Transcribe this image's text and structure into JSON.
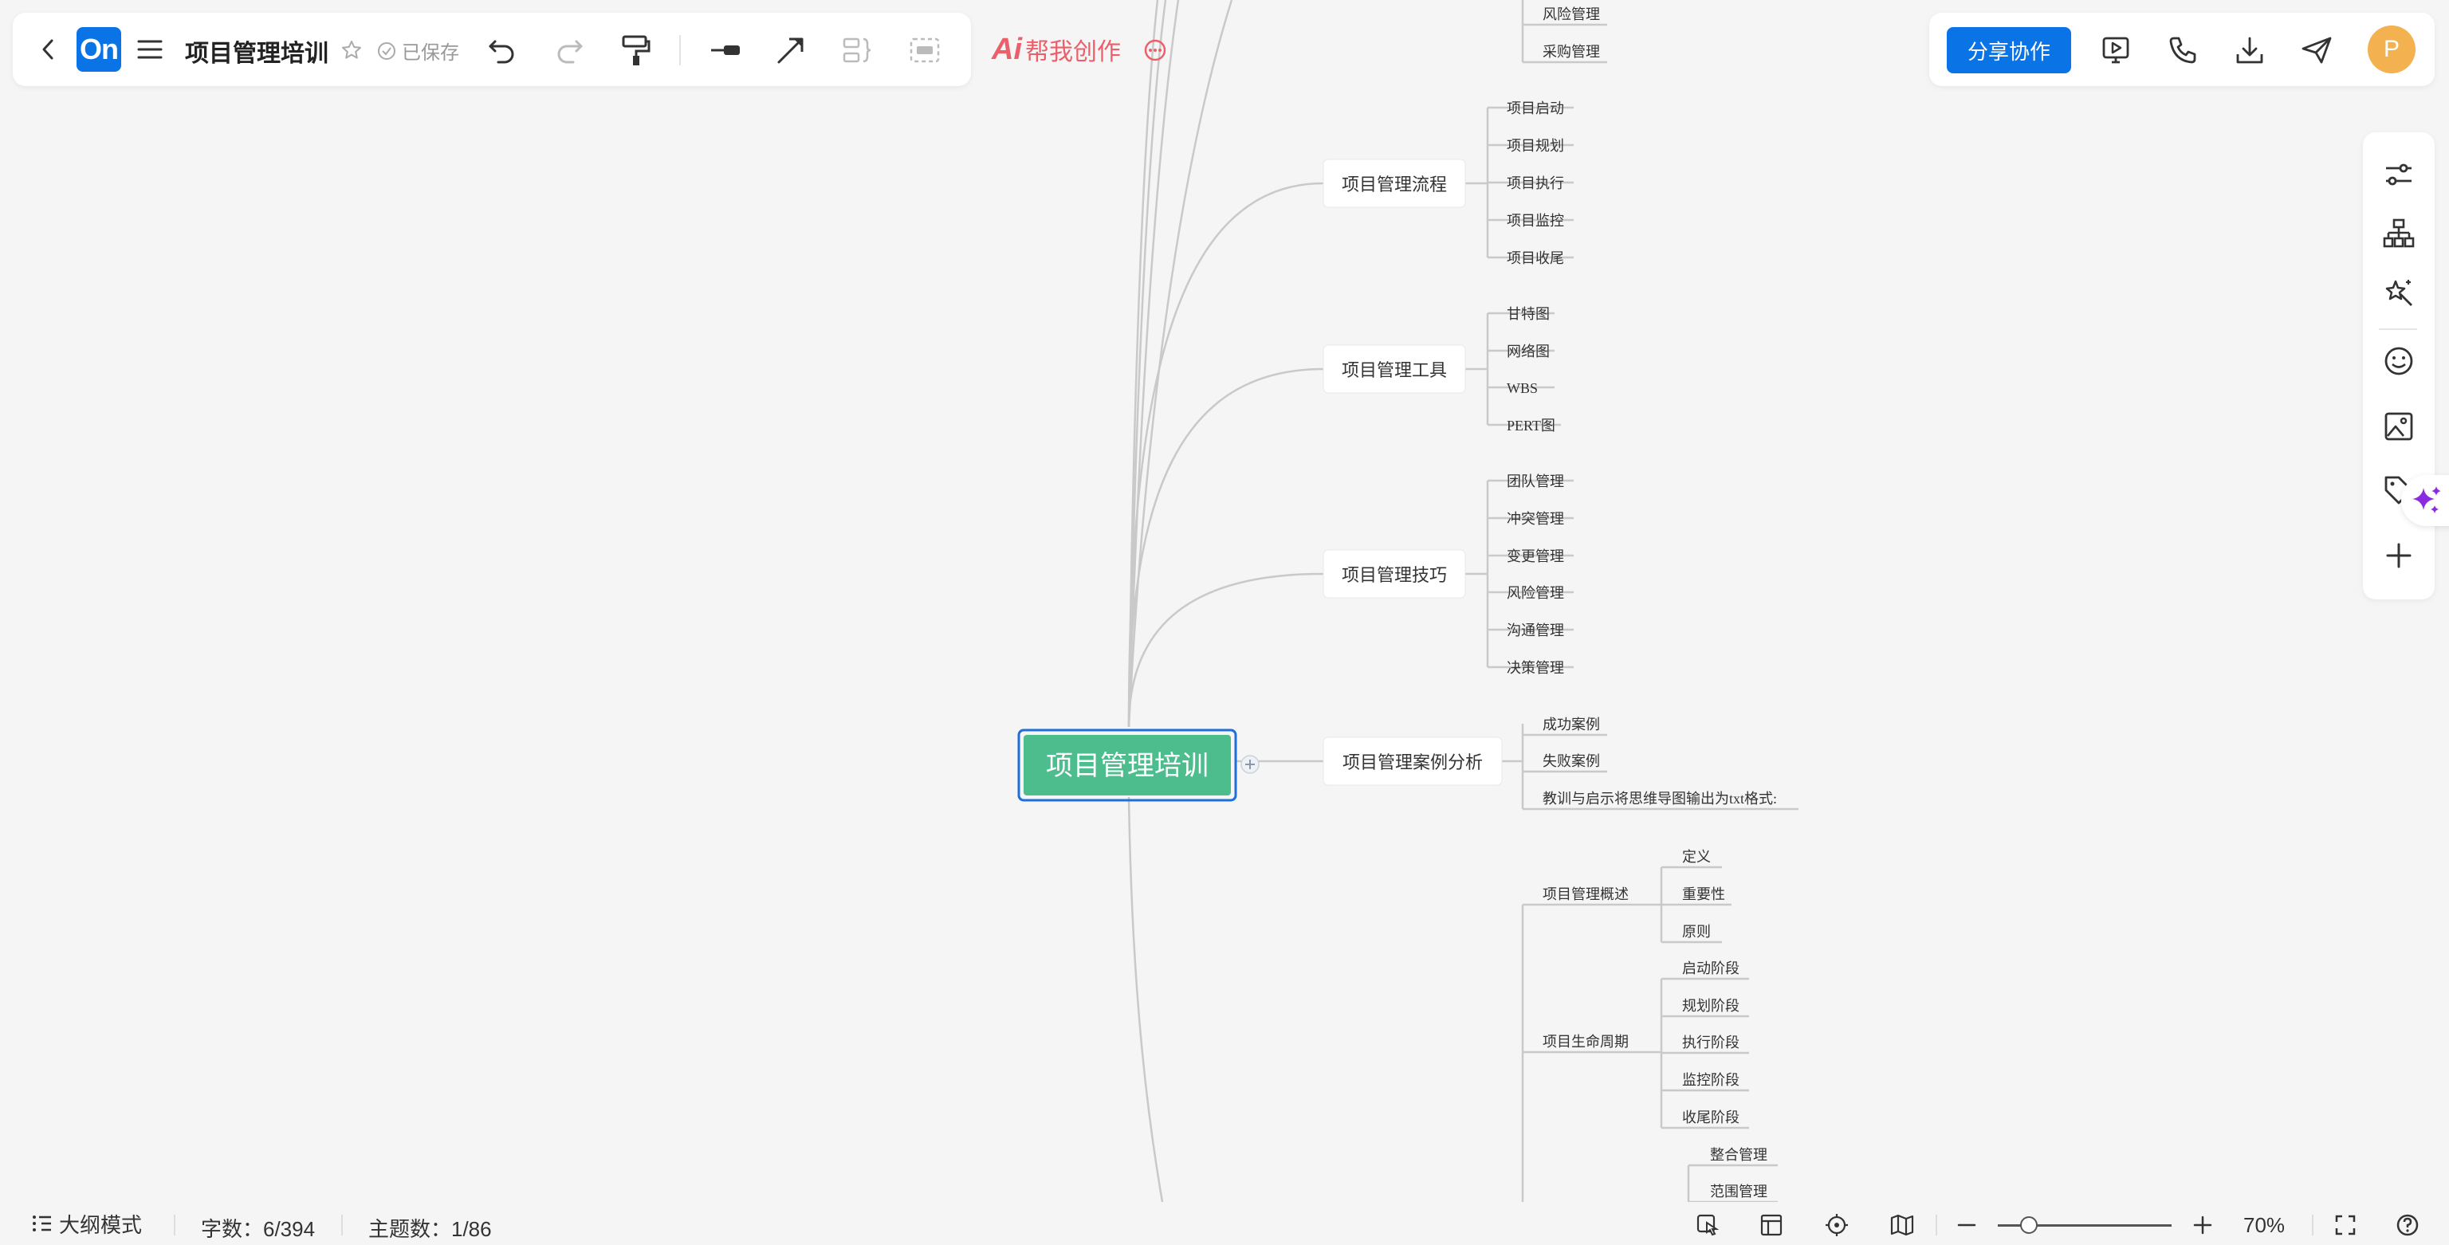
{
  "app": {
    "logo_text": "On",
    "title": "项目管理培训",
    "saved_status": "已保存",
    "ai_mark": "Ai",
    "ai_label": "帮我创作"
  },
  "header_right": {
    "share_label": "分享协作",
    "avatar_initial": "P"
  },
  "mindmap": {
    "root": "项目管理培训",
    "branches": {
      "flow": {
        "label": "项目管理流程",
        "children": [
          "项目启动",
          "项目规划",
          "项目执行",
          "项目监控",
          "项目收尾"
        ]
      },
      "tools": {
        "label": "项目管理工具",
        "children": [
          "甘特图",
          "网络图",
          "WBS",
          "PERT图"
        ]
      },
      "skills": {
        "label": "项目管理技巧",
        "children": [
          "团队管理",
          "冲突管理",
          "变更管理",
          "风险管理",
          "沟通管理",
          "决策管理"
        ]
      },
      "cases": {
        "label": "项目管理案例分析",
        "children": [
          "成功案例",
          "失败案例",
          "教训与启示将思维导图输出为txt格式:"
        ]
      }
    },
    "top_fragment": [
      "风险管理",
      "采购管理"
    ],
    "lower": {
      "overview": {
        "label": "项目管理概述",
        "children": [
          "定义",
          "重要性",
          "原则"
        ]
      },
      "lifecycle": {
        "label": "项目生命周期",
        "children": [
          "启动阶段",
          "规划阶段",
          "执行阶段",
          "监控阶段",
          "收尾阶段"
        ]
      },
      "knowledge_children": [
        "整合管理",
        "范围管理"
      ]
    }
  },
  "statusbar": {
    "outline_mode": "大纲模式",
    "word_count": "字数：6/394",
    "topic_count": "主题数：1/86",
    "zoom": "70%",
    "zoom_fraction": 0.17
  },
  "colors": {
    "brand": "#0a74e6",
    "root_fill": "#4dbd8d",
    "root_border": "#1e6fd9",
    "ai_red": "#ec5f6a",
    "connector": "#c9c9c9",
    "sparkle_purple": "#8a2be2",
    "avatar": "#f3b24f"
  },
  "icons": {
    "back": "chevron-left-icon",
    "menu": "menu-icon",
    "star": "star-icon",
    "undo": "undo-icon",
    "redo": "redo-icon",
    "format_painter": "format-painter-icon",
    "line_style": "line-style-icon",
    "arrow": "arrow-icon",
    "summary": "summary-bracket-icon",
    "boundary": "boundary-icon",
    "more": "more-icon",
    "present": "presentation-icon",
    "call": "phone-icon",
    "download": "download-icon",
    "send": "send-icon",
    "style": "style-sliders-icon",
    "structure": "structure-icon",
    "magic": "magic-icon",
    "emoji": "emoji-icon",
    "image": "image-icon",
    "tag": "tag-icon",
    "sparkle": "ai-sparkle-icon",
    "add": "plus-icon"
  }
}
